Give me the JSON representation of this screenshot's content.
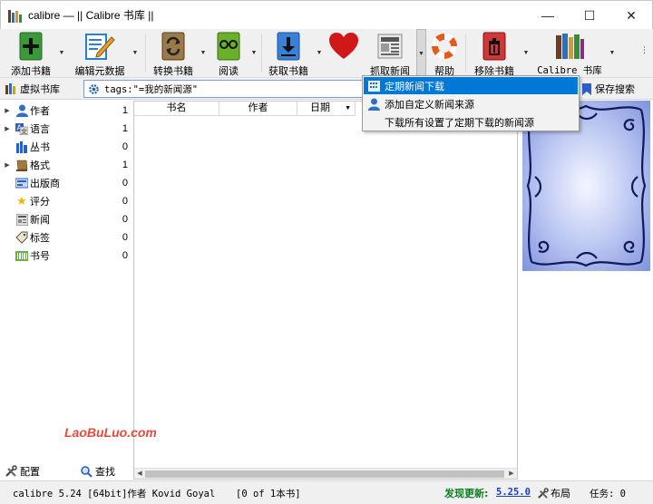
{
  "window": {
    "title": "calibre — || Calibre 书库 ||",
    "minimize": "—",
    "maximize": "☐",
    "close": "✕"
  },
  "toolbar": {
    "add_books": "添加书籍",
    "edit_metadata": "编辑元数据",
    "convert_books": "转换书籍",
    "view": "阅读",
    "get_books": "获取书籍",
    "fetch_news": "抓取新闻",
    "help": "帮助",
    "remove_books": "移除书籍",
    "calibre_library": "Calibre 书库",
    "colors": {
      "add": "#3a9a3a",
      "edit": "#2a7fd0",
      "convert": "#8a6a3a",
      "view": "#5aa02a",
      "get": "#2a6fc8",
      "heart": "#d01818",
      "remove": "#c83030"
    }
  },
  "searchbar": {
    "virtual_library": "虚拟书库",
    "query": "tags:\"=我的新闻源\"",
    "save_search": "保存搜索"
  },
  "tag_browser": {
    "items": [
      {
        "label": "作者",
        "count": "1",
        "expandable": true,
        "icon": "user-icon"
      },
      {
        "label": "语言",
        "count": "1",
        "expandable": true,
        "icon": "language-icon"
      },
      {
        "label": "丛书",
        "count": "0",
        "expandable": false,
        "icon": "series-icon"
      },
      {
        "label": "格式",
        "count": "1",
        "expandable": true,
        "icon": "format-icon"
      },
      {
        "label": "出版商",
        "count": "0",
        "expandable": false,
        "icon": "publisher-icon"
      },
      {
        "label": "评分",
        "count": "0",
        "expandable": false,
        "icon": "star-icon"
      },
      {
        "label": "新闻",
        "count": "0",
        "expandable": false,
        "icon": "news-icon"
      },
      {
        "label": "标签",
        "count": "0",
        "expandable": false,
        "icon": "tag-icon"
      },
      {
        "label": "书号",
        "count": "0",
        "expandable": false,
        "icon": "barcode-icon"
      }
    ],
    "configure": "配置",
    "find": "查找"
  },
  "book_list": {
    "columns": [
      "书名",
      "作者",
      "日期"
    ]
  },
  "news_menu": {
    "items": [
      {
        "label": "定期新闻下载",
        "highlighted": true,
        "icon": "schedule-icon"
      },
      {
        "label": "添加自定义新闻来源",
        "highlighted": false,
        "icon": "user-icon"
      },
      {
        "label": "下载所有设置了定期下载的新闻源",
        "highlighted": false,
        "icon": ""
      }
    ]
  },
  "watermark": "LaoBuLuo.com",
  "status": {
    "version": "calibre 5.24 [64bit]作者 Kovid Goyal",
    "book_count": "[0 of 1本书]",
    "update_label": "发现更新:",
    "update_version": "5.25.0",
    "layout": "布局",
    "jobs": "任务: 0"
  }
}
